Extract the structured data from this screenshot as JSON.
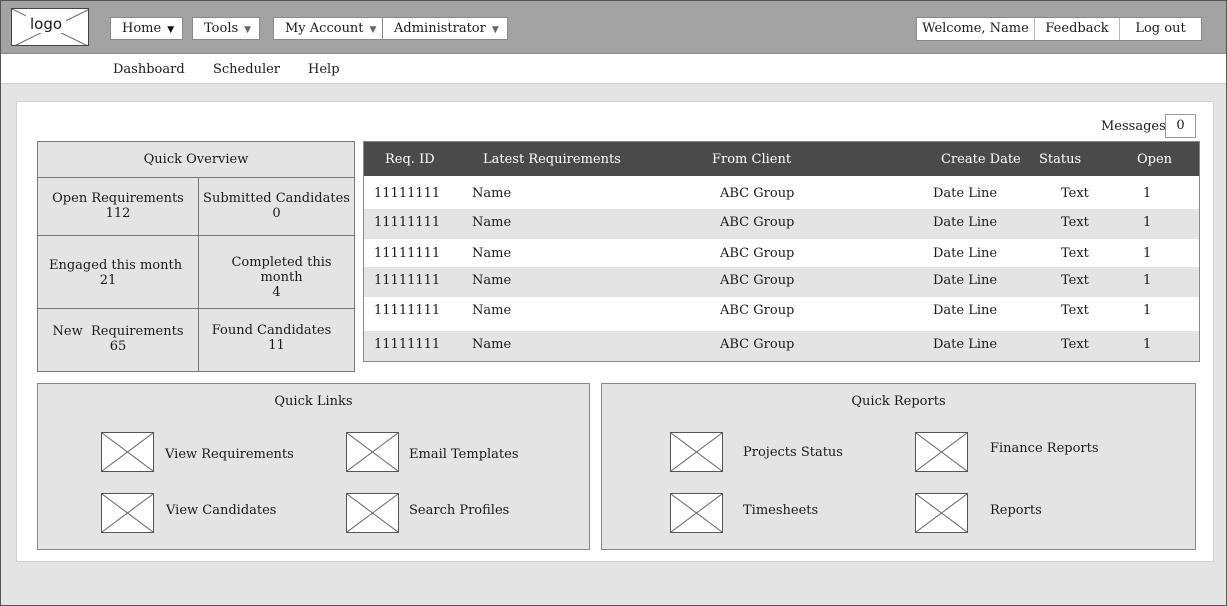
{
  "header": {
    "logo_text": "logo",
    "menus": [
      {
        "label": "Home"
      },
      {
        "label": "Tools"
      },
      {
        "label": "My Account"
      },
      {
        "label": "Administrator"
      }
    ],
    "welcome": "Welcome, Name",
    "feedback": "Feedback",
    "logout": "Log out"
  },
  "subnav": {
    "items": [
      "Dashboard",
      "Scheduler",
      "Help"
    ]
  },
  "messages": {
    "label": "Messages",
    "count": "0"
  },
  "overview": {
    "title": "Quick Overview",
    "cells": [
      {
        "label": "Open Requirements",
        "value": "112"
      },
      {
        "label": "Submitted Candidates",
        "value": "0"
      },
      {
        "label": "Engaged this month",
        "value": "21"
      },
      {
        "label": "Completed this month",
        "value": "4"
      },
      {
        "label": "New  Requirements",
        "value": "65"
      },
      {
        "label": "Found Candidates",
        "value": "11"
      }
    ]
  },
  "requirements": {
    "columns": [
      "Req. ID",
      "Latest Requirements",
      "From Client",
      "Create Date",
      "Status",
      "Open"
    ],
    "rows": [
      [
        "11111111",
        "Name",
        "ABC Group",
        "Date Line",
        "Text",
        "1"
      ],
      [
        "11111111",
        "Name",
        "ABC Group",
        "Date Line",
        "Text",
        "1"
      ],
      [
        "11111111",
        "Name",
        "ABC Group",
        "Date Line",
        "Text",
        "1"
      ],
      [
        "11111111",
        "Name",
        "ABC Group",
        "Date Line",
        "Text",
        "1"
      ],
      [
        "11111111",
        "Name",
        "ABC Group",
        "Date Line",
        "Text",
        "1"
      ],
      [
        "11111111",
        "Name",
        "ABC Group",
        "Date Line",
        "Text",
        "1"
      ]
    ]
  },
  "quick_links": {
    "title": "Quick Links",
    "items": [
      "View Requirements",
      "Email Templates",
      "View Candidates",
      "Search Profiles"
    ]
  },
  "quick_reports": {
    "title": "Quick Reports",
    "items": [
      "Projects Status",
      "Finance Reports",
      "Timesheets",
      "Reports"
    ]
  },
  "icons": {
    "placeholder": "image-placeholder-icon",
    "caret": "caret-down-icon"
  },
  "colors": {
    "topbar": "#a3a3a3",
    "table_header": "#4a4a4a",
    "panel": "#e4e4e4"
  }
}
